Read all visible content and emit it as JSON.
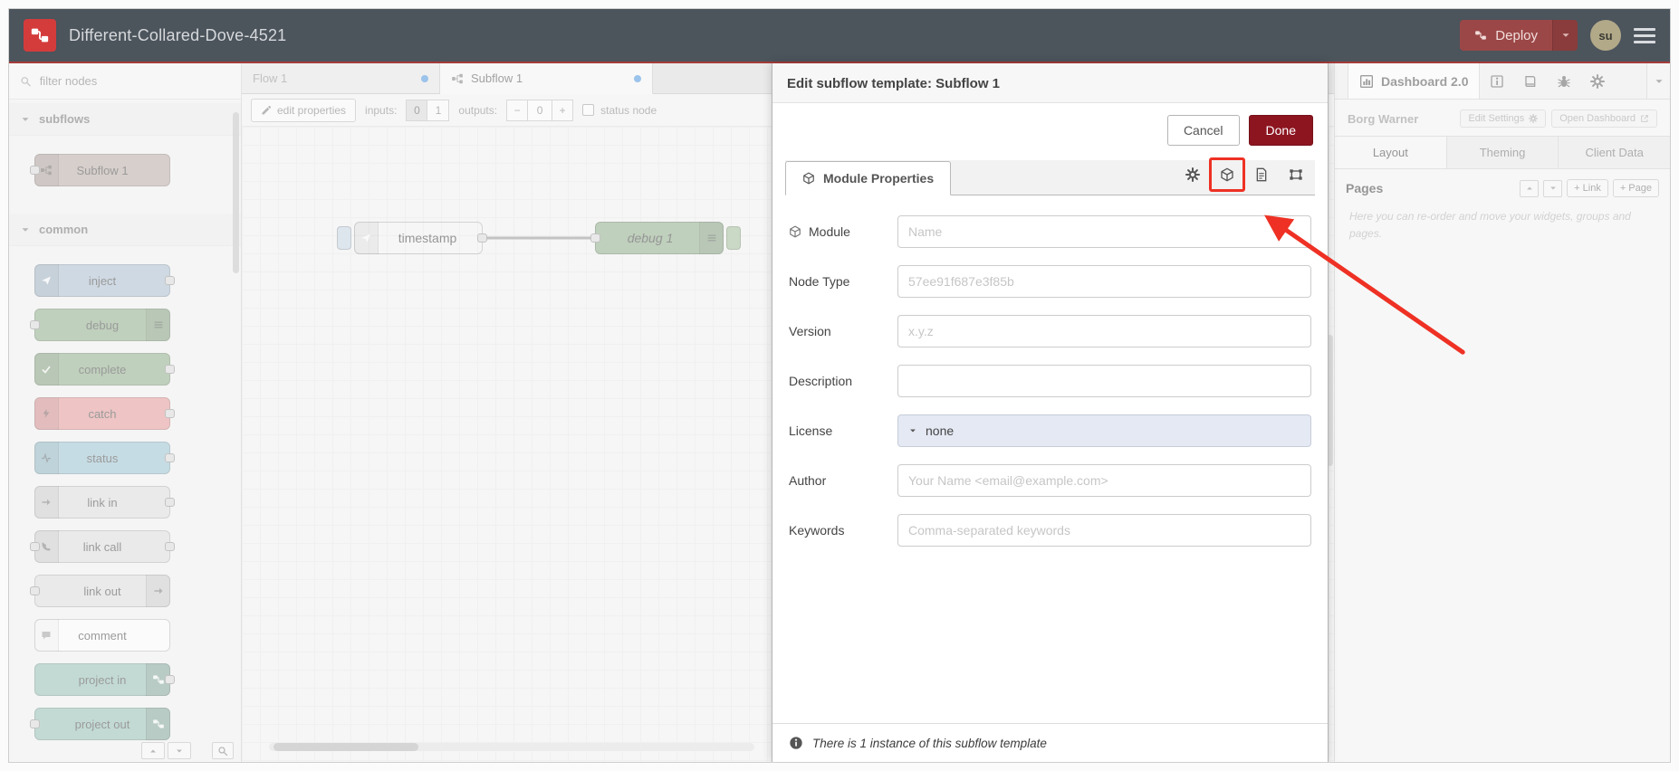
{
  "header": {
    "title": "Different-Collared-Dove-4521",
    "deploy_label": "Deploy",
    "avatar_initials": "su"
  },
  "palette": {
    "search_placeholder": "filter nodes",
    "sections": [
      {
        "label": "subflows",
        "items": [
          {
            "label": "Subflow 1",
            "css": "background:#b7a7a1"
          }
        ]
      },
      {
        "label": "common",
        "items": [
          {
            "label": "inject",
            "css": "background:#a6bbcf"
          },
          {
            "label": "debug",
            "css": "background:#87a980"
          },
          {
            "label": "complete",
            "css": "background:#87a980"
          },
          {
            "label": "catch",
            "css": "background:#e49191"
          },
          {
            "label": "status",
            "css": "background:#94c1d0"
          },
          {
            "label": "link in",
            "css": "background:#dddddd"
          },
          {
            "label": "link call",
            "css": "background:#dddddd"
          },
          {
            "label": "link out",
            "css": "background:#dddddd"
          },
          {
            "label": "comment",
            "css": "background:#ffffff"
          },
          {
            "label": "project in",
            "css": "background:#8fbdb0"
          },
          {
            "label": "project out",
            "css": "background:#8fbdb0"
          }
        ]
      }
    ]
  },
  "workspace": {
    "tabs": [
      {
        "label": "Flow 1",
        "active": false,
        "modified": true
      },
      {
        "label": "Subflow 1",
        "active": true,
        "modified": true
      }
    ],
    "toolbar": {
      "edit_properties_label": "edit properties",
      "inputs_label": "inputs:",
      "input_options": [
        "0",
        "1"
      ],
      "inputs_selected": "0",
      "outputs_label": "outputs:",
      "outputs_decrement": "−",
      "outputs_value": "0",
      "outputs_increment": "+",
      "status_node_label": "status node"
    },
    "canvas_nodes": {
      "inject": {
        "label": "timestamp",
        "css": "background:#a6bbcf"
      },
      "debug": {
        "label": "debug 1",
        "css": "background:#87a980"
      }
    }
  },
  "dialog": {
    "title": "Edit subflow template: Subflow 1",
    "cancel_label": "Cancel",
    "done_label": "Done",
    "tab_label": "Module Properties",
    "fields": {
      "module": {
        "label": "Module",
        "placeholder": "Name"
      },
      "node_type": {
        "label": "Node Type",
        "placeholder": "57ee91f687e3f85b"
      },
      "version": {
        "label": "Version",
        "placeholder": "x.y.z"
      },
      "description": {
        "label": "Description",
        "placeholder": ""
      },
      "license": {
        "label": "License",
        "value": "none"
      },
      "author": {
        "label": "Author",
        "placeholder": "Your Name <email@example.com>"
      },
      "keywords": {
        "label": "Keywords",
        "placeholder": "Comma-separated keywords"
      }
    },
    "footer_text": "There is 1 instance of this subflow template"
  },
  "sidebar": {
    "dashboard_tab_label": "Dashboard 2.0",
    "project_label": "Borg Warner",
    "edit_settings_label": "Edit Settings",
    "open_dashboard_label": "Open Dashboard",
    "tabs": [
      {
        "label": "Layout",
        "active": true
      },
      {
        "label": "Theming",
        "active": false
      },
      {
        "label": "Client Data",
        "active": false
      }
    ],
    "pages_label": "Pages",
    "link_button_label": "+ Link",
    "page_button_label": "+ Page",
    "help_text": "Here you can re-order and move your widgets, groups and pages."
  },
  "colors": {
    "header_bg": "#4c545c",
    "logo_red": "#d43c3c",
    "deploy_red": "#9c4747",
    "done_red": "#8c1520",
    "annotation_red": "#ee3124",
    "modified_dot_blue": "#3e8ede",
    "license_field_bg": "#e4e9f3"
  }
}
